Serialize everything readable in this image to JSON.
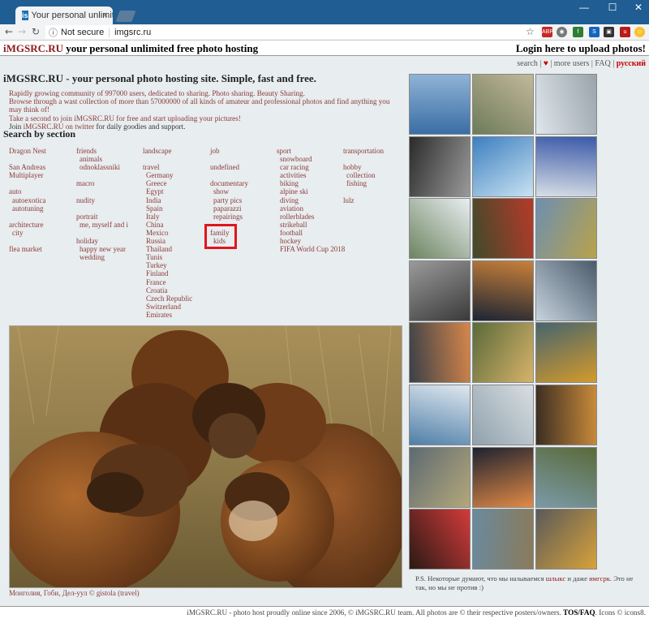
{
  "browser": {
    "tab_title": "Your personal unlimited",
    "favicon_text": "is",
    "tab_close": "×",
    "url_info": "Not secure",
    "url": "imgsrc.ru",
    "window_controls": {
      "minimize": "—",
      "maximize": "☐",
      "close": "✕"
    }
  },
  "header": {
    "logo": "iMGSRC.RU",
    "tagline": "your personal unlimited free photo hosting",
    "login": "Login here to upload photos!"
  },
  "topnav": {
    "search": "search",
    "sep1": " | ",
    "heart": "♥",
    "sep2": " | ",
    "more_users": "more users",
    "sep3": " | ",
    "faq": "FAQ",
    "sep4": " | ",
    "russian": "русский"
  },
  "hero": {
    "title": "iMGSRC.RU - your personal photo hosting site. Simple, fast and free.",
    "line1_link": "Rapidly growing community",
    "line1_rest": " of 997000 users, dedicated to sharing. Photo sharing. Beauty Sharing.",
    "line2": "Browse through a wast collection of more than 57000000 of all kinds of amateur and professional photos and find anything you may think of!",
    "line3": "Take a second to join iMGSRC.RU for free and start uploading your pictures!",
    "line4_pre": "Join ",
    "line4_link": "iMGSRC.RU on twitter",
    "line4_rest": " for daily goodies and support."
  },
  "sections": {
    "title": "Search by section",
    "col1": [
      "Dragon Nest",
      "",
      "San Andreas",
      "Multiplayer",
      "",
      "auto",
      "  autoexotica",
      "  autotuning",
      "",
      "architecture",
      "  city",
      "",
      "flea market"
    ],
    "col2": [
      "friends",
      "  animals",
      "  odnoklassniki",
      "",
      "macro",
      "",
      "nudity",
      "",
      "portrait",
      "  me, myself and i",
      "",
      "holiday",
      "  happy new year",
      "  wedding"
    ],
    "col3": [
      "landscape",
      "",
      "travel",
      "  Germany",
      "  Greece",
      "  Egypt",
      "  India",
      "  Spain",
      "  Italy",
      "  China",
      "  Mexico",
      "  Russia",
      "  Thailand",
      "  Tunis",
      "  Turkey",
      "  Finland",
      "  France",
      "  Croatia",
      "  Czech Republic",
      "  Switzerland",
      "  Emirates"
    ],
    "col4": [
      "job",
      "",
      "undefined",
      "",
      "documentary",
      "  show",
      "  party pics",
      "  paparazzi",
      "  repairings",
      "",
      "family",
      "  kids"
    ],
    "col5": [
      "sport",
      "  snowboard",
      "  car racing",
      "  activities",
      "  biking",
      "  alpine ski",
      "  diving",
      "  aviation",
      "  rollerblades",
      "  strikeball",
      "  football",
      "  hockey",
      "  FIFA World Cup 2018"
    ],
    "col6": [
      "transportation",
      "",
      "hobby",
      "  collection",
      "  fishing",
      "",
      "lulz"
    ]
  },
  "featured": {
    "caption": "Монголия, Гоби, Дел-уул © gistola (travel)"
  },
  "ps": {
    "pre": "P.S. Некоторые думают, что мы называемся ",
    "link1": "шлыкс",
    "mid": " и даже ",
    "link2": "имгсрк",
    "post": ". Это не так, но мы не против :)"
  },
  "footer": {
    "pre": "iMGSRC.RU - photo host proudly online since 2006, © iMGSRC.RU team. All photos are © their respective posters/owners. ",
    "tos": "TOS/FAQ",
    "post": ". Icons © icons8."
  },
  "colors": {
    "accent": "#8b1a1a",
    "link": "#8b3a3a",
    "highlight": "#e1151c",
    "browser_bar": "#1f5d92"
  }
}
